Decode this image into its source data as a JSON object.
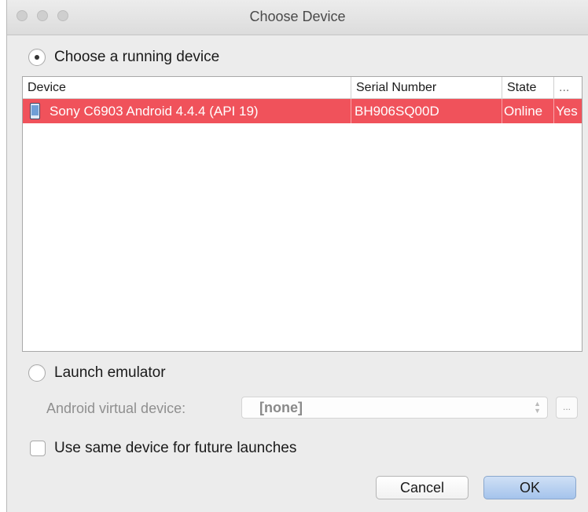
{
  "window": {
    "title": "Choose Device"
  },
  "running": {
    "label": "Choose a running device",
    "selected": true
  },
  "table": {
    "columns": [
      "Device",
      "Serial Number",
      "State",
      "..."
    ],
    "rows": [
      {
        "device": "Sony C6903 Android 4.4.4 (API 19)",
        "serial": "BH906SQ00D",
        "state": "Online",
        "extra": "Yes"
      }
    ],
    "selected_row_color": "#f0525b"
  },
  "emulator": {
    "label": "Launch emulator",
    "selected": false,
    "avd_label": "Android virtual device:",
    "avd_value": "[none]",
    "browse_label": "..."
  },
  "same_device": {
    "label": "Use same device for future launches",
    "checked": false
  },
  "buttons": {
    "cancel": "Cancel",
    "ok": "OK"
  }
}
